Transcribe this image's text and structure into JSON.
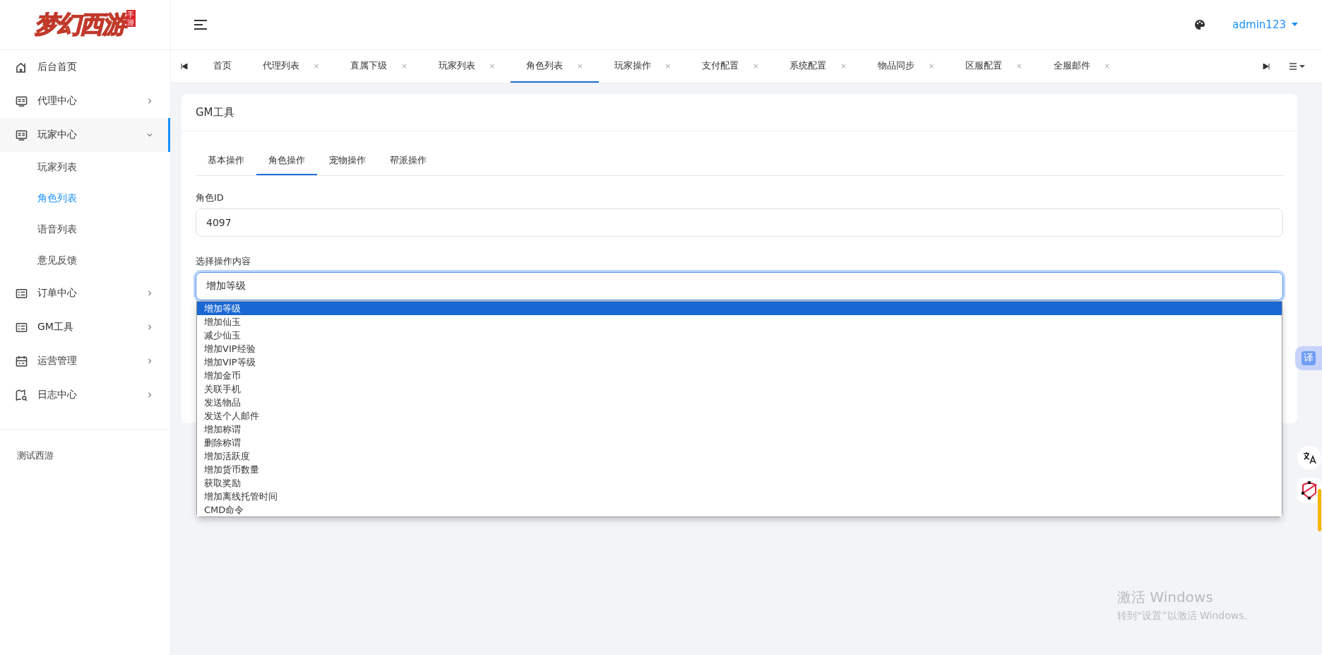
{
  "logo": {
    "title": "梦幻西游",
    "tag": "手游"
  },
  "sidebar": {
    "items": [
      {
        "label": "后台首页",
        "kind": "home",
        "has_children": false,
        "expanded": false
      },
      {
        "label": "代理中心",
        "kind": "monitor",
        "has_children": true,
        "expanded": false
      },
      {
        "label": "玩家中心",
        "kind": "monitor",
        "has_children": true,
        "expanded": true,
        "children": [
          {
            "label": "玩家列表",
            "selected": false
          },
          {
            "label": "角色列表",
            "selected": true
          },
          {
            "label": "语音列表",
            "selected": false
          },
          {
            "label": "意见反馈",
            "selected": false
          }
        ]
      },
      {
        "label": "订单中心",
        "kind": "list",
        "has_children": true,
        "expanded": false
      },
      {
        "label": "GM工具",
        "kind": "list",
        "has_children": true,
        "expanded": false
      },
      {
        "label": "运营管理",
        "kind": "calendar",
        "has_children": true,
        "expanded": false
      },
      {
        "label": "日志中心",
        "kind": "map",
        "has_children": true,
        "expanded": false
      }
    ],
    "footer": "测试西游"
  },
  "header": {
    "user": "admin123"
  },
  "tabs": [
    {
      "label": "首页",
      "closable": false,
      "selected": false
    },
    {
      "label": "代理列表",
      "closable": true,
      "selected": false
    },
    {
      "label": "直属下级",
      "closable": true,
      "selected": false
    },
    {
      "label": "玩家列表",
      "closable": true,
      "selected": false
    },
    {
      "label": "角色列表",
      "closable": true,
      "selected": true
    },
    {
      "label": "玩家操作",
      "closable": true,
      "selected": false
    },
    {
      "label": "支付配置",
      "closable": true,
      "selected": false
    },
    {
      "label": "系统配置",
      "closable": true,
      "selected": false
    },
    {
      "label": "物品同步",
      "closable": true,
      "selected": false
    },
    {
      "label": "区服配置",
      "closable": true,
      "selected": false
    },
    {
      "label": "全服邮件",
      "closable": true,
      "selected": false
    }
  ],
  "tab_close": "×",
  "card": {
    "title": "GM工具",
    "subtabs": [
      {
        "label": "基本操作",
        "selected": false
      },
      {
        "label": "角色操作",
        "selected": true
      },
      {
        "label": "宠物操作",
        "selected": false
      },
      {
        "label": "帮派操作",
        "selected": false
      }
    ],
    "role_id": {
      "label": "角色ID",
      "value": "4097"
    },
    "operation": {
      "label": "选择操作内容",
      "value": "增加等级",
      "options": [
        {
          "label": "增加等级",
          "selected": true
        },
        {
          "label": "增加仙玉",
          "selected": false
        },
        {
          "label": "减少仙玉",
          "selected": false
        },
        {
          "label": "增加VIP经验",
          "selected": false
        },
        {
          "label": "增加VIP等级",
          "selected": false
        },
        {
          "label": "增加金币",
          "selected": false
        },
        {
          "label": "关联手机",
          "selected": false
        },
        {
          "label": "发送物品",
          "selected": false
        },
        {
          "label": "发送个人邮件",
          "selected": false
        },
        {
          "label": "增加称谓",
          "selected": false
        },
        {
          "label": "删除称谓",
          "selected": false
        },
        {
          "label": "增加活跃度",
          "selected": false
        },
        {
          "label": "增加货币数量",
          "selected": false
        },
        {
          "label": "获取奖励",
          "selected": false
        },
        {
          "label": "增加离线托管时间",
          "selected": false
        },
        {
          "label": "CMD命令",
          "selected": false
        }
      ]
    }
  },
  "translate_badge": "译",
  "os_notice": {
    "title": "激活 Windows",
    "text": "转到“设置”以激活 Windows。"
  }
}
